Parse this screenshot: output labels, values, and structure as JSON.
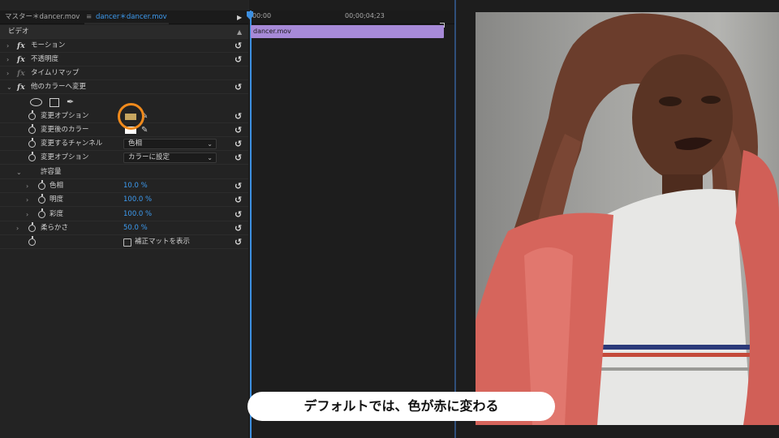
{
  "panel": {
    "tabs": [
      {
        "label": "マスター＊dancer.mov"
      },
      {
        "label": "dancer＊dancer.mov"
      }
    ],
    "tab_menu_glyph": "≡",
    "play_glyph": "▶",
    "section_label": "ビデオ",
    "section_collapse_glyph": "▲",
    "reset_glyph": "↺",
    "rows": {
      "motion": "モーション",
      "opacity": "不透明度",
      "time_remap": "タイムリマップ",
      "change_to_color": "他のカラーへ変更",
      "from": "変更オプション",
      "to": "変更後のカラー",
      "change_channel": "変更するチャンネル",
      "change_option": "変更オプション",
      "tolerance": "許容量",
      "hue": "色相",
      "lightness": "明度",
      "saturation": "彩度",
      "softness": "柔らかさ"
    },
    "values": {
      "hue": "10.0 %",
      "lightness": "100.0 %",
      "saturation": "100.0 %",
      "softness": "50.0 %"
    },
    "dropdowns": {
      "change_channel": "色相",
      "change_option": "カラーに設定"
    },
    "checkbox_label": "補正マットを表示",
    "colors": {
      "from_swatch": "#c7a660",
      "to_swatch": "#ffffff",
      "highlight_ring": "#f08a1c",
      "accent_blue": "#3d9bf0",
      "clip": "#a78ad8"
    }
  },
  "timeline": {
    "timecode_start": "00:00",
    "timecode_end": "00;00;04;23",
    "clip_name": "dancer.mov"
  },
  "caption": {
    "text": "デフォルトでは、色が赤に変わる"
  }
}
